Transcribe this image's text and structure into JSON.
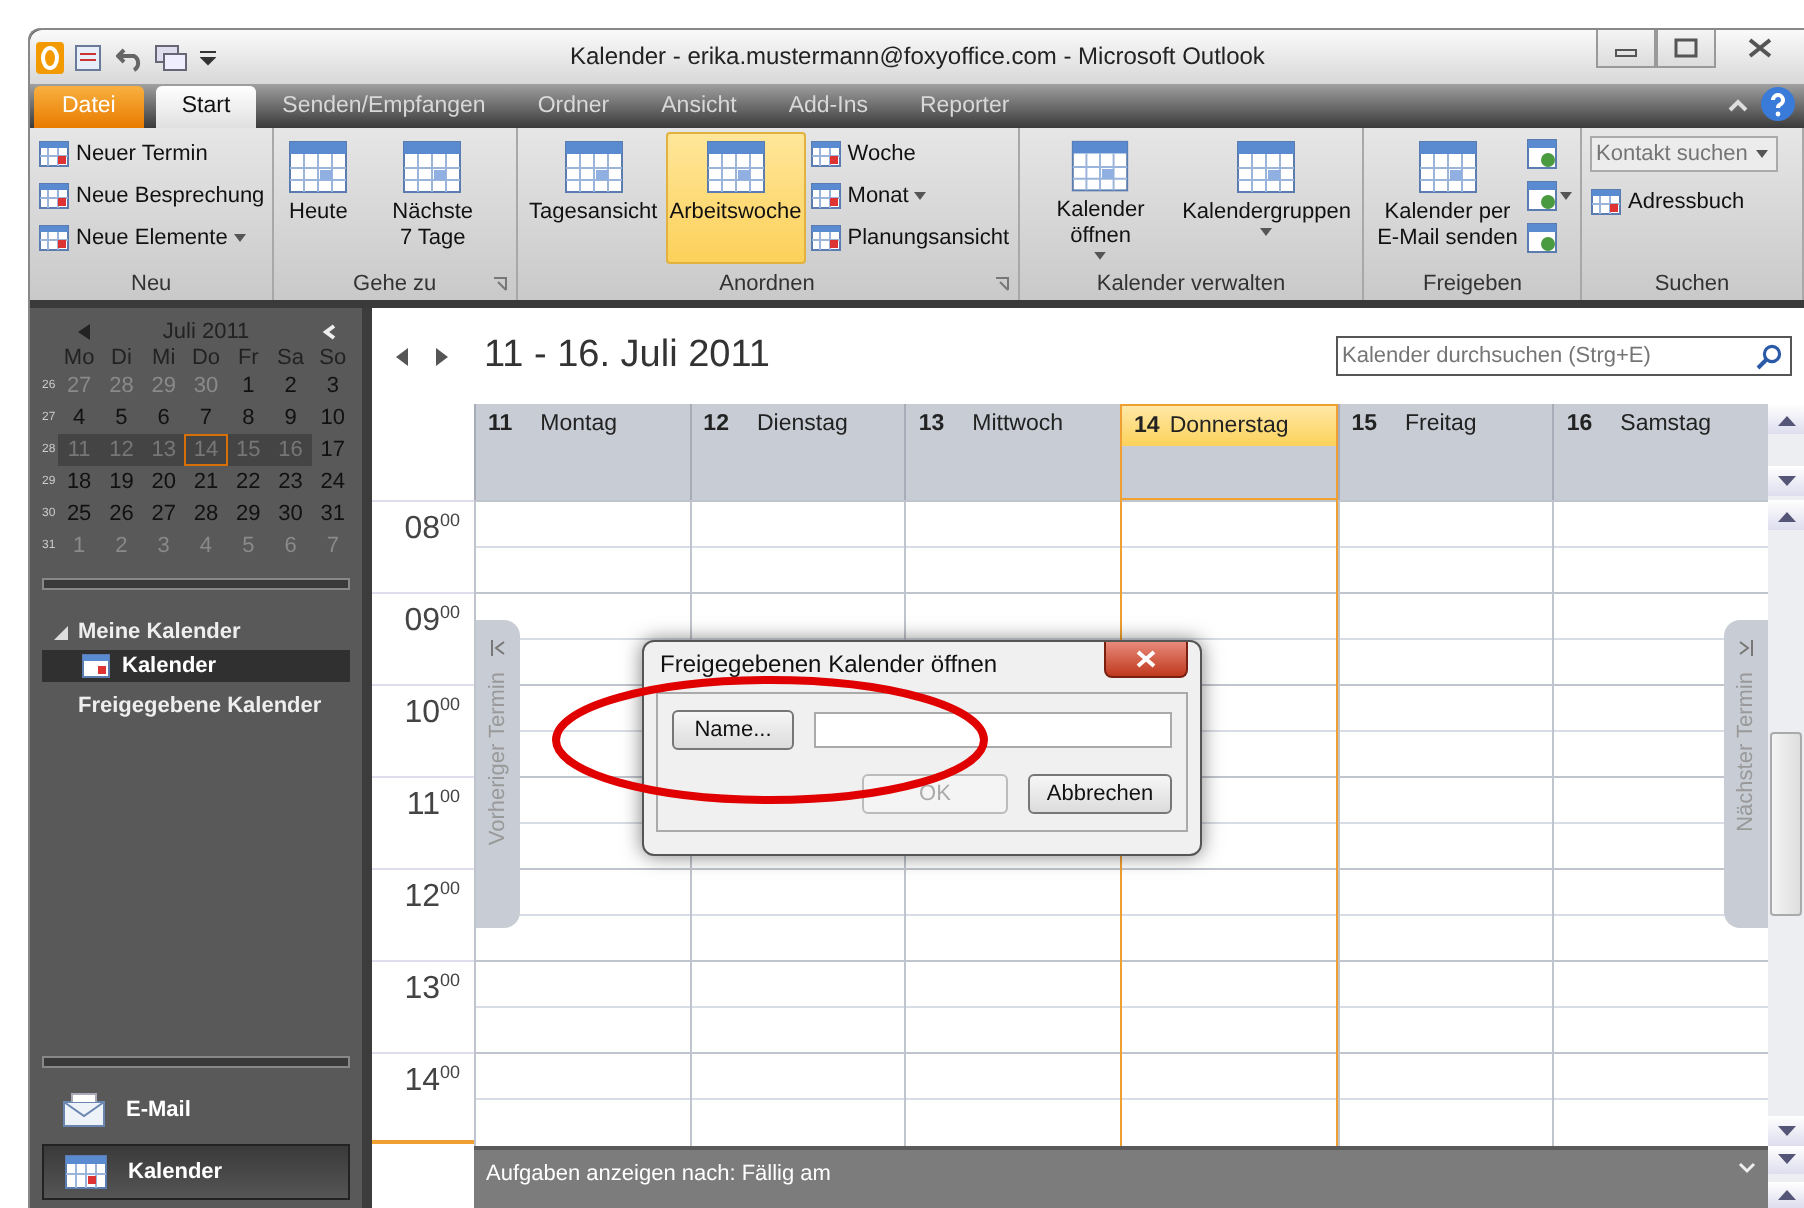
{
  "window": {
    "title": "Kalender - erika.mustermann@foxyoffice.com  -  Microsoft Outlook"
  },
  "ribbon_tabs": [
    {
      "label": "Datei",
      "kind": "file",
      "selected": false
    },
    {
      "label": "Start",
      "kind": "tab",
      "selected": true
    },
    {
      "label": "Senden/Empfangen",
      "kind": "tab",
      "selected": false
    },
    {
      "label": "Ordner",
      "kind": "tab",
      "selected": false
    },
    {
      "label": "Ansicht",
      "kind": "tab",
      "selected": false
    },
    {
      "label": "Add-Ins",
      "kind": "tab",
      "selected": false
    },
    {
      "label": "Reporter",
      "kind": "tab",
      "selected": false
    }
  ],
  "ribbon_groups": [
    {
      "label": "Neu",
      "launcher": false,
      "items": [
        {
          "kind": "small",
          "label": "Neuer Termin",
          "dropdown": false
        },
        {
          "kind": "small",
          "label": "Neue Besprechung",
          "dropdown": false
        },
        {
          "kind": "small",
          "label": "Neue Elemente",
          "dropdown": true
        }
      ]
    },
    {
      "label": "Gehe zu",
      "launcher": true,
      "items": [
        {
          "kind": "large",
          "label": "Heute",
          "dropdown": false,
          "selected": false
        },
        {
          "kind": "large",
          "label": "Nächste 7 Tage",
          "dropdown": false,
          "selected": false
        }
      ]
    },
    {
      "label": "Anordnen",
      "launcher": true,
      "items": [
        {
          "kind": "large",
          "label": "Tagesansicht",
          "dropdown": false,
          "selected": false
        },
        {
          "kind": "large",
          "label": "Arbeitswoche",
          "dropdown": false,
          "selected": true
        },
        {
          "kind": "small",
          "label": "Woche",
          "dropdown": false
        },
        {
          "kind": "small",
          "label": "Monat",
          "dropdown": true
        },
        {
          "kind": "small",
          "label": "Planungsansicht",
          "dropdown": false
        }
      ]
    },
    {
      "label": "Kalender verwalten",
      "launcher": false,
      "items": [
        {
          "kind": "large",
          "label": "Kalender öffnen",
          "dropdown": true,
          "selected": false
        },
        {
          "kind": "large",
          "label": "Kalendergruppen",
          "dropdown": true,
          "selected": false
        }
      ]
    },
    {
      "label": "Freigeben",
      "launcher": false,
      "items": [
        {
          "kind": "large",
          "label": "Kalender per E-Mail senden",
          "dropdown": false,
          "selected": false
        },
        {
          "kind": "icon",
          "dropdown": false
        },
        {
          "kind": "icon",
          "dropdown": true
        },
        {
          "kind": "icon",
          "dropdown": false
        }
      ]
    },
    {
      "label": "Suchen",
      "launcher": false,
      "items": [
        {
          "kind": "search",
          "placeholder": "Kontakt suchen",
          "dropdown": true
        },
        {
          "kind": "small",
          "label": "Adressbuch",
          "dropdown": false
        }
      ]
    }
  ],
  "date_navigator": {
    "month": "Juli 2011",
    "weekdays": [
      "Mo",
      "Di",
      "Mi",
      "Do",
      "Fr",
      "Sa",
      "So"
    ],
    "weeks": [
      {
        "number": "26",
        "days": [
          {
            "label": "27",
            "muted": true,
            "selected": false,
            "today": false
          },
          {
            "label": "28",
            "muted": true,
            "selected": false,
            "today": false
          },
          {
            "label": "29",
            "muted": true,
            "selected": false,
            "today": false
          },
          {
            "label": "30",
            "muted": true,
            "selected": false,
            "today": false
          },
          {
            "label": "1",
            "muted": false,
            "selected": false,
            "today": false
          },
          {
            "label": "2",
            "muted": false,
            "selected": false,
            "today": false
          },
          {
            "label": "3",
            "muted": false,
            "selected": false,
            "today": false
          }
        ]
      },
      {
        "number": "27",
        "days": [
          {
            "label": "4",
            "muted": false,
            "selected": false,
            "today": false
          },
          {
            "label": "5",
            "muted": false,
            "selected": false,
            "today": false
          },
          {
            "label": "6",
            "muted": false,
            "selected": false,
            "today": false
          },
          {
            "label": "7",
            "muted": false,
            "selected": false,
            "today": false
          },
          {
            "label": "8",
            "muted": false,
            "selected": false,
            "today": false
          },
          {
            "label": "9",
            "muted": false,
            "selected": false,
            "today": false
          },
          {
            "label": "10",
            "muted": false,
            "selected": false,
            "today": false
          }
        ]
      },
      {
        "number": "28",
        "days": [
          {
            "label": "11",
            "muted": true,
            "selected": true,
            "today": false
          },
          {
            "label": "12",
            "muted": true,
            "selected": true,
            "today": false
          },
          {
            "label": "13",
            "muted": true,
            "selected": true,
            "today": false
          },
          {
            "label": "14",
            "muted": true,
            "selected": true,
            "today": true
          },
          {
            "label": "15",
            "muted": true,
            "selected": true,
            "today": false
          },
          {
            "label": "16",
            "muted": true,
            "selected": true,
            "today": false
          },
          {
            "label": "17",
            "muted": false,
            "selected": false,
            "today": false
          }
        ]
      },
      {
        "number": "29",
        "days": [
          {
            "label": "18",
            "muted": false,
            "selected": false,
            "today": false
          },
          {
            "label": "19",
            "muted": false,
            "selected": false,
            "today": false
          },
          {
            "label": "20",
            "muted": false,
            "selected": false,
            "today": false
          },
          {
            "label": "21",
            "muted": false,
            "selected": false,
            "today": false
          },
          {
            "label": "22",
            "muted": false,
            "selected": false,
            "today": false
          },
          {
            "label": "23",
            "muted": false,
            "selected": false,
            "today": false
          },
          {
            "label": "24",
            "muted": false,
            "selected": false,
            "today": false
          }
        ]
      },
      {
        "number": "30",
        "days": [
          {
            "label": "25",
            "muted": false,
            "selected": false,
            "today": false
          },
          {
            "label": "26",
            "muted": false,
            "selected": false,
            "today": false
          },
          {
            "label": "27",
            "muted": false,
            "selected": false,
            "today": false
          },
          {
            "label": "28",
            "muted": false,
            "selected": false,
            "today": false
          },
          {
            "label": "29",
            "muted": false,
            "selected": false,
            "today": false
          },
          {
            "label": "30",
            "muted": false,
            "selected": false,
            "today": false
          },
          {
            "label": "31",
            "muted": false,
            "selected": false,
            "today": false
          }
        ]
      },
      {
        "number": "31",
        "days": [
          {
            "label": "1",
            "muted": true,
            "selected": false,
            "today": false
          },
          {
            "label": "2",
            "muted": true,
            "selected": false,
            "today": false
          },
          {
            "label": "3",
            "muted": true,
            "selected": false,
            "today": false
          },
          {
            "label": "4",
            "muted": true,
            "selected": false,
            "today": false
          },
          {
            "label": "5",
            "muted": true,
            "selected": false,
            "today": false
          },
          {
            "label": "6",
            "muted": true,
            "selected": false,
            "today": false
          },
          {
            "label": "7",
            "muted": true,
            "selected": false,
            "today": false
          }
        ]
      }
    ]
  },
  "folders": {
    "groups": [
      {
        "label": "Meine Kalender",
        "expanded": true,
        "children": [
          {
            "label": "Kalender",
            "selected": true
          }
        ]
      }
    ],
    "shared_label": "Freigegebene Kalender"
  },
  "nav_buttons": [
    {
      "label": "E-Mail",
      "kind": "mail",
      "selected": false
    },
    {
      "label": "Kalender",
      "kind": "calendar",
      "selected": true
    }
  ],
  "calendar": {
    "range": "11 - 16. Juli 2011",
    "search": {
      "placeholder": "Kalender durchsuchen (Strg+E)"
    },
    "days": [
      {
        "number": "11",
        "name": "Montag",
        "today": false
      },
      {
        "number": "12",
        "name": "Dienstag",
        "today": false
      },
      {
        "number": "13",
        "name": "Mittwoch",
        "today": false
      },
      {
        "number": "14",
        "name": "Donnerstag",
        "today": true
      },
      {
        "number": "15",
        "name": "Freitag",
        "today": false
      },
      {
        "number": "16",
        "name": "Samstag",
        "today": false
      }
    ],
    "hours": [
      {
        "hour": "08",
        "minutes": "00"
      },
      {
        "hour": "09",
        "minutes": "00"
      },
      {
        "hour": "10",
        "minutes": "00"
      },
      {
        "hour": "11",
        "minutes": "00"
      },
      {
        "hour": "12",
        "minutes": "00"
      },
      {
        "hour": "13",
        "minutes": "00"
      },
      {
        "hour": "14",
        "minutes": "00"
      }
    ],
    "previous_tab": "Vorheriger Termin",
    "next_tab": "Nächster Termin",
    "tasks_bar": "Aufgaben anzeigen nach: Fällig am"
  },
  "dialog": {
    "title": "Freigegebenen Kalender öffnen",
    "name_button": "Name...",
    "ok": {
      "label": "OK",
      "disabled": true
    },
    "cancel": "Abbrechen"
  }
}
